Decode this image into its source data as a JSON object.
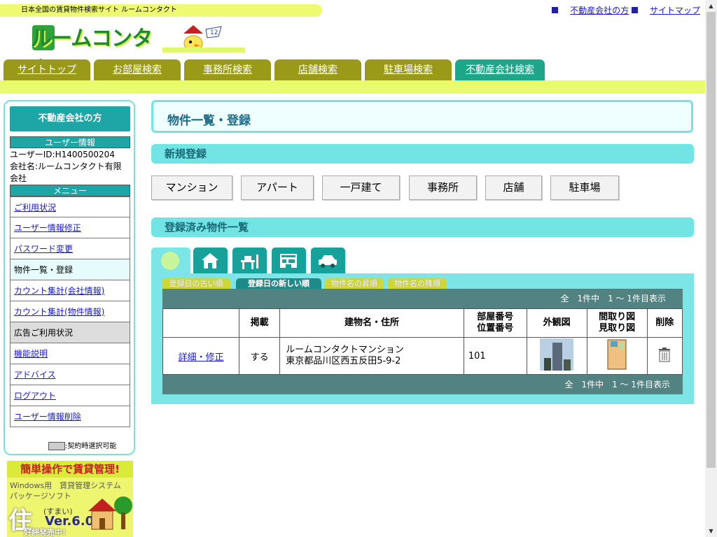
{
  "header": {
    "tagline": "日本全国の賃貸物件検索サイト ルームコンタクト",
    "logo_text": "ルームコンタクト",
    "links": [
      "不動産会社の方",
      "サイトマップ"
    ]
  },
  "nav": {
    "tabs": [
      "サイトトップ",
      "お部屋検索",
      "事務所検索",
      "店舗検索",
      "駐車場検索",
      "不動産会社検索"
    ],
    "active_index": 5
  },
  "sidebar": {
    "title": "不動産会社の方",
    "user_info_label": "ユーザー情報",
    "user_id": "ユーザーID:H1400500204",
    "company": "会社名:ルームコンタクト有限会社",
    "menu_label": "メニュー",
    "menu": [
      "ご利用状況",
      "ユーザー情報修正",
      "パスワード変更",
      "物件一覧・登録",
      "カウント集計(会社情報)",
      "カウント集計(物件情報)",
      "広告ご利用状況",
      "機能説明",
      "アドバイス",
      "ログアウト",
      "ユーザー情報削除"
    ],
    "legend": ":契約時選択可能"
  },
  "ad": {
    "headline": "簡単操作で賃貸管理!",
    "line1": "Windows用　賃貸管理システム",
    "line2": "パッケージソフト",
    "name": "住",
    "reading": "(すまい)",
    "version": "Ver.6.0",
    "footer": "好評発売中!"
  },
  "main": {
    "page_title": "物件一覧・登録",
    "new_section": "新規登録",
    "buttons": [
      "マンション",
      "アパート",
      "一戸建て",
      "事務所",
      "店舗",
      "駐車場"
    ],
    "list_section": "登録済み物件一覧",
    "sort_tabs": [
      "登録日の古い順",
      "登録日の新しい順",
      "物件名の昇順",
      "物件名の降順"
    ],
    "sort_active": 1,
    "pager_top": "全　1件中　1 ～ 1件目表示",
    "pager_bottom": "全　1件中　1 ～ 1件目表示",
    "table": {
      "headers": [
        "",
        "掲載",
        "建物名・住所",
        "部屋番号\n位置番号",
        "外観図",
        "間取り図\n見取り図",
        "削除"
      ],
      "rows": [
        {
          "action": "詳細・修正",
          "published": "する",
          "name": "ルームコンタクトマンション",
          "address": "東京都品川区西五反田5-9-2",
          "room": "101"
        }
      ]
    }
  },
  "colors": {
    "teal": "#1ea6a6",
    "nav_olive": "#9a9918",
    "lime": "#e8fb6a",
    "light_cyan": "#72e4e4"
  }
}
